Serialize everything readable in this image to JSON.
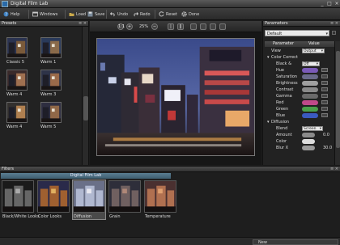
{
  "window": {
    "title": "Digital Film Lab",
    "controls": [
      "_",
      "□",
      "×"
    ]
  },
  "toolbar": {
    "help": "Help",
    "windows": "Windows",
    "load": "Load",
    "save": "Save",
    "undo": "Undo",
    "redo": "Redo",
    "reset": "Reset",
    "done": "Done"
  },
  "presets": {
    "title": "Presets",
    "controls": "≡ ×",
    "items": [
      {
        "label": "Classic 5"
      },
      {
        "label": "Warm 1"
      },
      {
        "label": "Warm 4"
      },
      {
        "label": "Warm 3"
      },
      {
        "label": "Warm 4"
      },
      {
        "label": "Warm 5"
      }
    ]
  },
  "viewbar": {
    "zoom": "25%"
  },
  "parameters": {
    "title": "Parameters",
    "controls": "≡ ×",
    "preset": "Default",
    "col_param": "Parameter",
    "col_value": "Value",
    "view_label": "View",
    "view_value": "Output",
    "groups": {
      "color_correct": "Color Correct",
      "diffusion": "Diffusion"
    },
    "rows": {
      "black": "Black &",
      "black_value": "Off",
      "hue": "Hue",
      "saturation": "Saturation",
      "brightness": "Brightness",
      "contrast": "Contrast",
      "gamma": "Gamma",
      "red": "Red",
      "green": "Green",
      "blue": "Blue",
      "blend": "Blend",
      "blend_value": "Screen",
      "amount": "Amount",
      "amount_value": "0.0",
      "color": "Color",
      "blurx": "Blur X",
      "blurx_value": "30.0"
    },
    "pill_colors": {
      "hue": "#7a5ab8",
      "saturation": "#6a6a8a",
      "brightness": "#a0a0a0",
      "contrast": "#8a8a8a",
      "gamma": "#6a6a6a",
      "red": "#c04a8a",
      "green": "#4aa04a",
      "blue": "#3a5ac0"
    }
  },
  "filters": {
    "title": "Filters",
    "controls": "≡ ×",
    "subheader": "Digital Film Lab",
    "items": [
      {
        "label": "Black/White Looks"
      },
      {
        "label": "Color Looks"
      },
      {
        "label": "Diffusion"
      },
      {
        "label": "Grain"
      },
      {
        "label": "Temperature"
      }
    ]
  },
  "status": {
    "text": "New"
  }
}
